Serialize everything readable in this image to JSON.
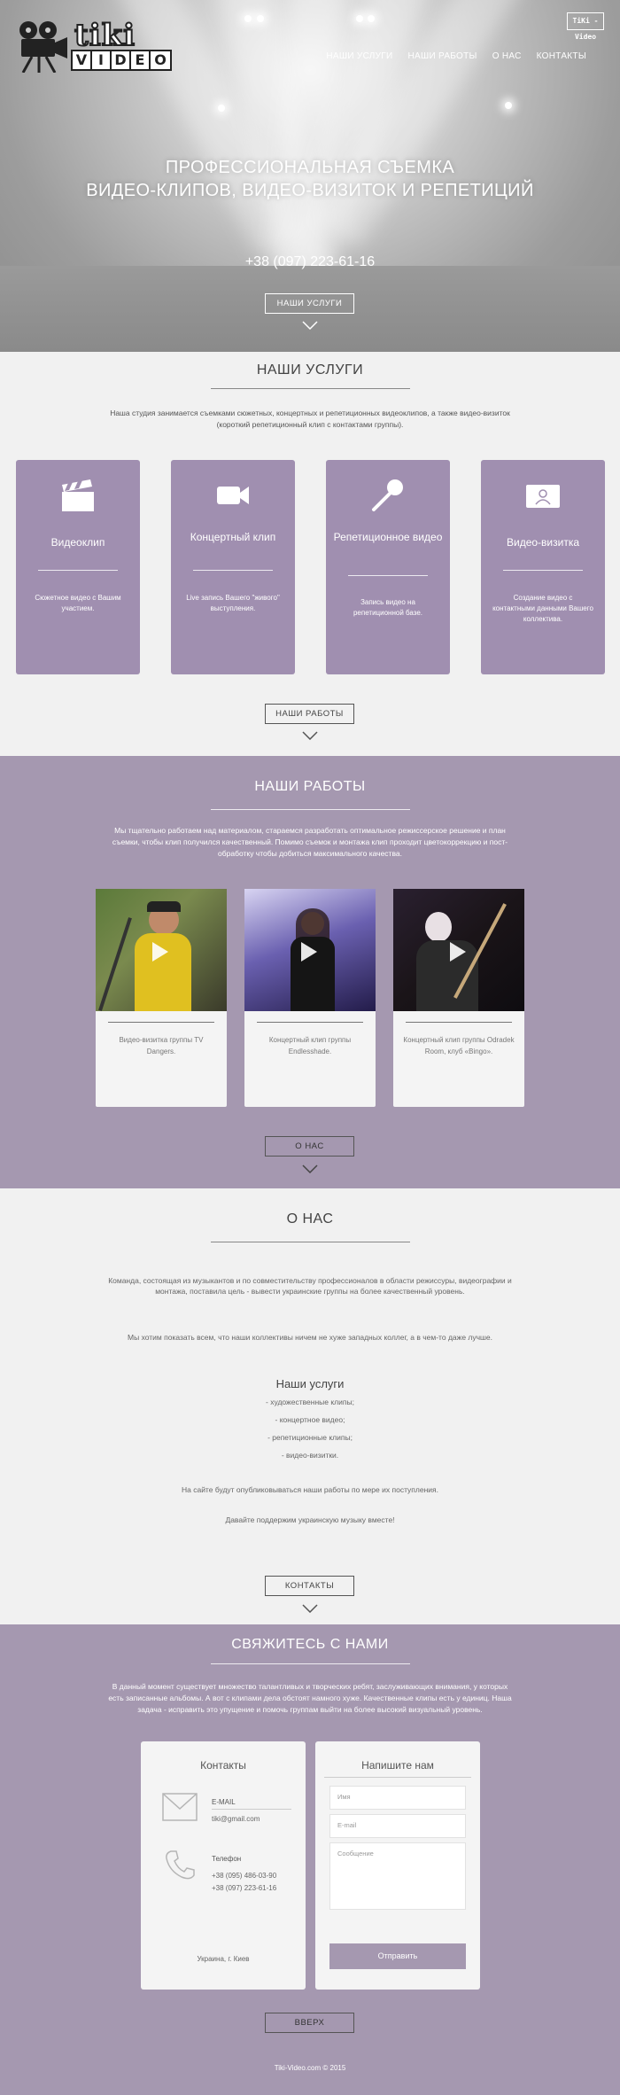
{
  "brand": {
    "logo_top": "tiki",
    "logo_letters": [
      "V",
      "I",
      "D",
      "E",
      "O"
    ],
    "badge": "TiKi - Video"
  },
  "nav": [
    "НАШИ УСЛУГИ",
    "НАШИ РАБОТЫ",
    "О НАС",
    "КОНТАКТЫ"
  ],
  "hero": {
    "title_line1": "ПРОФЕССИОНАЛЬНАЯ СЪЕМКА",
    "title_line2": "ВИДЕО-КЛИПОВ, ВИДЕО-ВИЗИТОК И РЕПЕТИЦИЙ",
    "phone": "+38 (097) 223-61-16",
    "button": "НАШИ УСЛУГИ"
  },
  "services": {
    "title": "НАШИ УСЛУГИ",
    "intro": "Наша студия занимается съемками сюжетных, концертных и репетиционных видеоклипов, а также видео-визиток (короткий репетиционный клип с контактами группы).",
    "cards": [
      {
        "name": "Видеоклип",
        "desc": "Сюжетное видео с Вашим участием.",
        "icon": "clapperboard-icon"
      },
      {
        "name": "Концертный клип",
        "desc": "Live запись Вашего \"живого\" выступления.",
        "icon": "video-camera-icon"
      },
      {
        "name": "Репетиционное видео",
        "desc": "Запись видео на репетиционной базе.",
        "icon": "microphone-icon"
      },
      {
        "name": "Видео-визитка",
        "desc": "Создание видео с контактными данными Вашего коллектива.",
        "icon": "id-card-icon"
      }
    ],
    "button": "НАШИ РАБОТЫ"
  },
  "works": {
    "title": "НАШИ РАБОТЫ",
    "intro": "Мы тщательно работаем над материалом, стараемся разработать оптимальное режиссерское решение и план съемки, чтобы клип получился качественный. Помимо съемок и монтажа клип проходит цветокоррекцию и пост-обработку чтобы добиться максимального качества.",
    "items": [
      {
        "caption": "Видео-визитка группы TV Dangers."
      },
      {
        "caption": "Концертный клип группы Endlesshade."
      },
      {
        "caption": "Концертный клип группы Odradek Room, клуб «Bingo»."
      }
    ],
    "button": "О НАС"
  },
  "about": {
    "title": "О НАС",
    "p1": "Команда, состоящая из музыкантов и по совместительству профессионалов в области режиссуры, видеографии и монтажа, поставила цель - вывести украинские группы на более качественный уровень.",
    "p2": "Мы хотим показать всем, что наши коллективы ничем не хуже западных коллег, а в чем-то даже лучше.",
    "subtitle": "Наши услуги",
    "list": [
      "- художественные клипы;",
      "- концертное видео;",
      "- репетиционные клипы;",
      "- видео-визитки."
    ],
    "p3": "На сайте будут опубликовываться наши работы по мере их поступления.",
    "p4": "Давайте поддержим украинскую музыку вместе!",
    "button": "КОНТАКТЫ"
  },
  "contact": {
    "title": "СВЯЖИТЕСЬ С НАМИ",
    "intro": "В данный момент существует множество талантливых и творческих ребят, заслуживающих внимания, у которых есть записанные альбомы. А вот с клипами дела обстоят намного хуже. Качественные клипы есть у единиц. Наша задача - исправить это упущение и помочь группам выйти на более высокий визуальный уровень.",
    "card_title": "Контакты",
    "email_label": "E-MAIL",
    "email": "tiki@gmail.com",
    "phone_label": "Телефон",
    "phones": [
      "+38 (095) 486-03-90",
      "+38 (097) 223-61-16"
    ],
    "location": "Украина, г. Киев",
    "form_title": "Напишите нам",
    "name_placeholder": "Имя",
    "email_placeholder": "E-mail",
    "message_placeholder": "Сообщение",
    "send": "Отправить",
    "top_button": "ВВЕРХ",
    "footer": "Tiki-Video.com © 2015"
  },
  "colors": {
    "accent": "#a598b0",
    "card": "#a08fb0"
  }
}
